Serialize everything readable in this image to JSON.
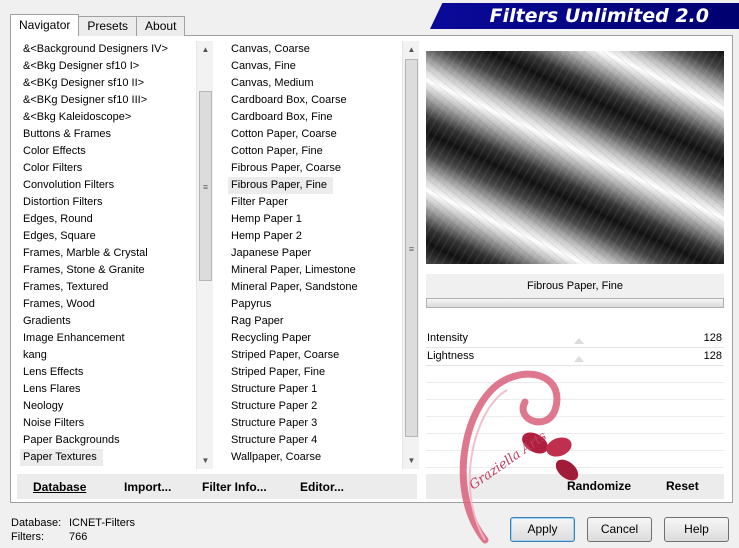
{
  "app": {
    "title": "Filters Unlimited 2.0"
  },
  "tabs": [
    {
      "label": "Navigator"
    },
    {
      "label": "Presets"
    },
    {
      "label": "About"
    }
  ],
  "categories": [
    "&<Background Designers IV>",
    "&<Bkg Designer sf10 I>",
    "&<BKg Designer sf10 II>",
    "&<BKg Designer sf10 III>",
    "&<Bkg Kaleidoscope>",
    "Buttons & Frames",
    "Color Effects",
    "Color Filters",
    "Convolution Filters",
    "Distortion Filters",
    "Edges, Round",
    "Edges, Square",
    "Frames, Marble & Crystal",
    "Frames, Stone & Granite",
    "Frames, Textured",
    "Frames, Wood",
    "Gradients",
    "Image Enhancement",
    "kang",
    "Lens Effects",
    "Lens Flares",
    "Neology",
    "Noise Filters",
    "Paper Backgrounds",
    "Paper Textures"
  ],
  "categories_selected": "Paper Textures",
  "filters": [
    "Canvas, Coarse",
    "Canvas, Fine",
    "Canvas, Medium",
    "Cardboard Box, Coarse",
    "Cardboard Box, Fine",
    "Cotton Paper, Coarse",
    "Cotton Paper, Fine",
    "Fibrous Paper, Coarse",
    "Fibrous Paper, Fine",
    "Filter Paper",
    "Hemp Paper 1",
    "Hemp Paper 2",
    "Japanese Paper",
    "Mineral Paper, Limestone",
    "Mineral Paper, Sandstone",
    "Papyrus",
    "Rag Paper",
    "Recycling Paper",
    "Striped Paper, Coarse",
    "Striped Paper, Fine",
    "Structure Paper 1",
    "Structure Paper 2",
    "Structure Paper 3",
    "Structure Paper 4",
    "Wallpaper, Coarse"
  ],
  "filters_selected": "Fibrous Paper, Fine",
  "preview": {
    "filter_name": "Fibrous Paper, Fine"
  },
  "params": [
    {
      "label": "Intensity",
      "value": "128"
    },
    {
      "label": "Lightness",
      "value": "128"
    }
  ],
  "toolbar": {
    "database": "Database",
    "import": "Import...",
    "filter_info": "Filter Info...",
    "editor": "Editor...",
    "randomize": "Randomize",
    "reset": "Reset"
  },
  "status": {
    "database_label": "Database:",
    "database_value": "ICNET-Filters",
    "filters_label": "Filters:",
    "filters_value": "766"
  },
  "buttons": {
    "apply": "Apply",
    "cancel": "Cancel",
    "help": "Help"
  },
  "watermark": {
    "text": "Graziella Arts"
  }
}
